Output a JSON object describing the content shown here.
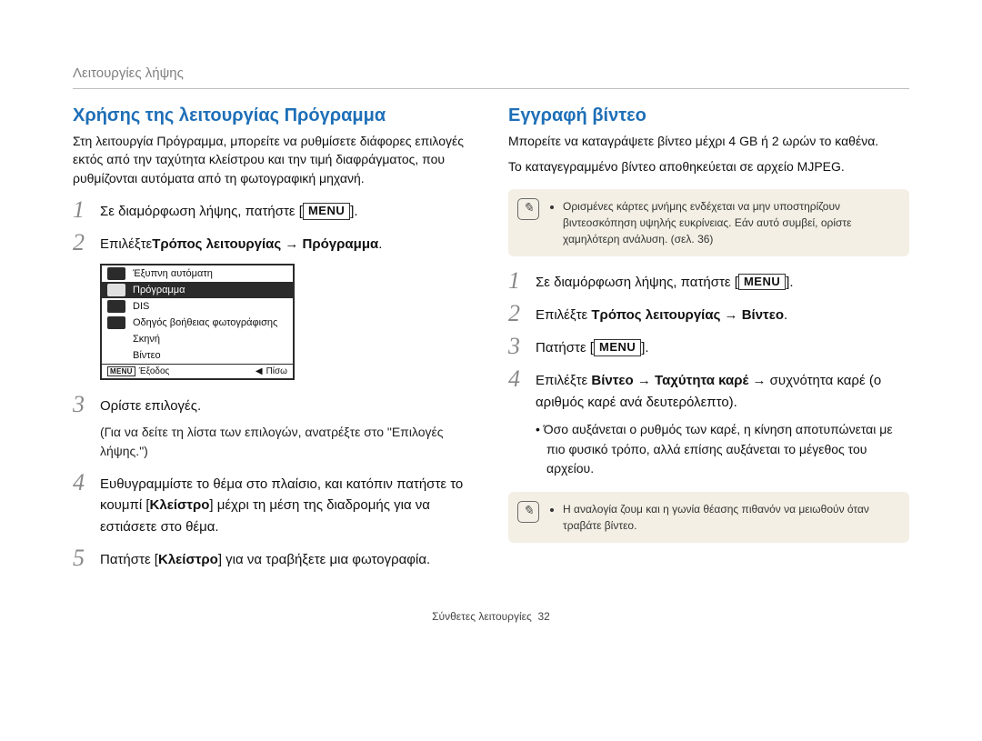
{
  "breadcrumb": "Λειτουργίες λήψης",
  "left": {
    "title": "Χρήσης της λειτουργίας Πρόγραμμα",
    "intro": "Στη λειτουργία Πρόγραμμα, μπορείτε να ρυθμίσετε διάφορες επιλογές εκτός από την ταχύτητα κλείστρου και την τιμή διαφράγματος, που ρυθμίζονται αυτόματα από τη φωτογραφική μηχανή.",
    "step1_pre": "Σε διαμόρφωση λήψης, πατήστε [",
    "step1_menu": "MENU",
    "step1_post": "].",
    "step2_pre": "Επιλέξτε",
    "step2_bold": "Τρόπος λειτουργίας → Πρόγραμμα",
    "step2_post": ".",
    "step3_line1": "Ορίστε επιλογές.",
    "step3_line2": "(Για να δείτε τη λίστα των επιλογών, ανατρέξτε στο \"Επιλογές λήψης.\")",
    "step4_pre": "Ευθυγραμμίστε το θέμα στο πλαίσιο, και κατόπιν πατήστε το κουμπί [",
    "step4_bold": "Κλείστρο",
    "step4_post": "] μέχρι τη μέση της διαδρομής για να εστιάσετε στο θέμα.",
    "step5_pre": "Πατήστε [",
    "step5_bold": "Κλείστρο",
    "step5_post": "] για να τραβήξετε μια φωτογραφία.",
    "menu": {
      "items": [
        "Έξυπνη αυτόματη",
        "Πρόγραμμα",
        "DIS",
        "Οδηγός βοήθειας φωτογράφισης",
        "Σκηνή",
        "Βίντεο"
      ],
      "footer_left": "Έξοδος",
      "footer_right": "Πίσω",
      "menu_label": "MENU"
    }
  },
  "right": {
    "title": "Εγγραφή βίντεο",
    "intro1": "Μπορείτε να καταγράψετε βίντεο μέχρι 4 GB ή 2 ωρών το καθένα.",
    "intro2": "Το καταγεγραμμένο βίντεο αποθηκεύεται σε αρχείο MJPEG.",
    "note1": "Ορισμένες κάρτες μνήμης ενδέχεται να μην υποστηρίζουν βιντεοσκόπηση υψηλής ευκρίνειας. Εάν αυτό συμβεί, ορίστε χαμηλότερη ανάλυση. (σελ. 36)",
    "step1_pre": "Σε διαμόρφωση λήψης, πατήστε [",
    "step1_menu": "MENU",
    "step1_post": "].",
    "step2_pre": "Επιλέξτε ",
    "step2_bold": "Τρόπος λειτουργίας → Βίντεο",
    "step2_post": ".",
    "step3_pre": "Πατήστε [",
    "step3_menu": "MENU",
    "step3_post": "].",
    "step4_pre": "Επιλέξτε ",
    "step4_bold": "Βίντεο → Ταχύτητα καρέ",
    "step4_post": " → συχνότητα καρέ (ο αριθμός καρέ ανά δευτερόλεπτο).",
    "step4_bullet": "Όσο αυξάνεται ο ρυθμός των καρέ, η κίνηση αποτυπώνεται με πιο φυσικό τρόπο, αλλά επίσης αυξάνεται το μέγεθος του αρχείου.",
    "note2": "Η αναλογία ζουμ και η γωνία θέασης πιθανόν να μειωθούν όταν τραβάτε βίντεο."
  },
  "footer": {
    "label": "Σύνθετες λειτουργίες",
    "page": "32"
  }
}
